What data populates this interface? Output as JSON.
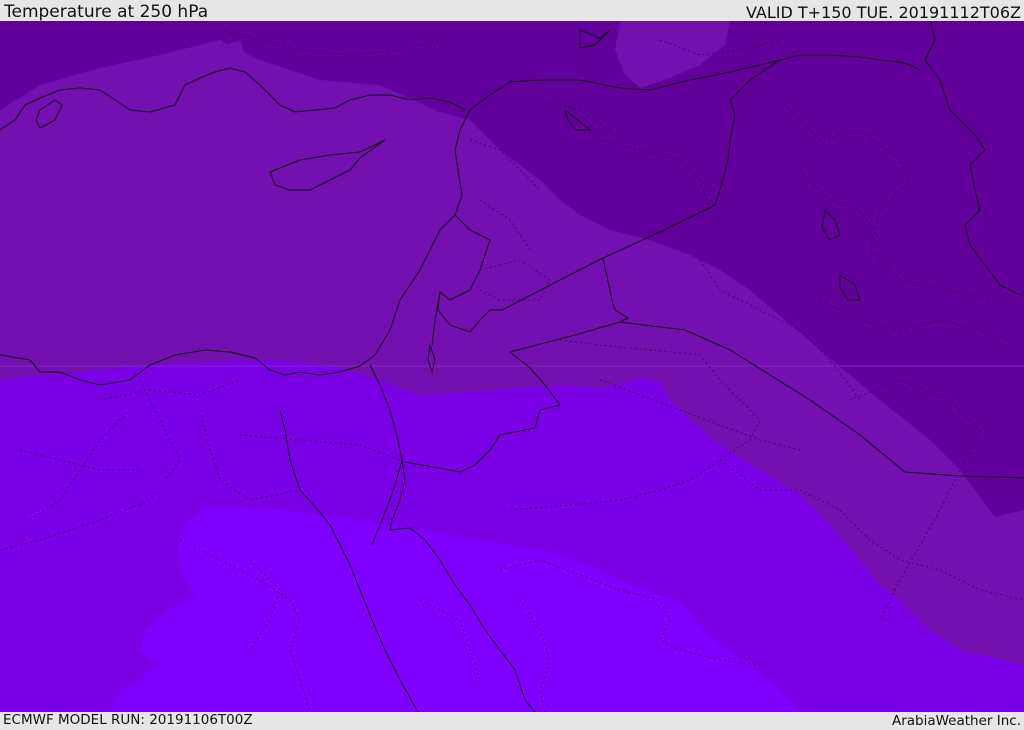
{
  "header": {
    "title": "Temperature at 250 hPa",
    "valid": "VALID T+150 TUE. 20191112T06Z"
  },
  "footer": {
    "model_run": "ECMWF MODEL RUN: 20191106T00Z",
    "credit": "ArabiaWeather Inc."
  },
  "map": {
    "colors": {
      "darkest": "#62009b",
      "dark": "#7410b0",
      "mid": "#7a00e6",
      "light": "#8000ff",
      "border": "#111111"
    }
  }
}
